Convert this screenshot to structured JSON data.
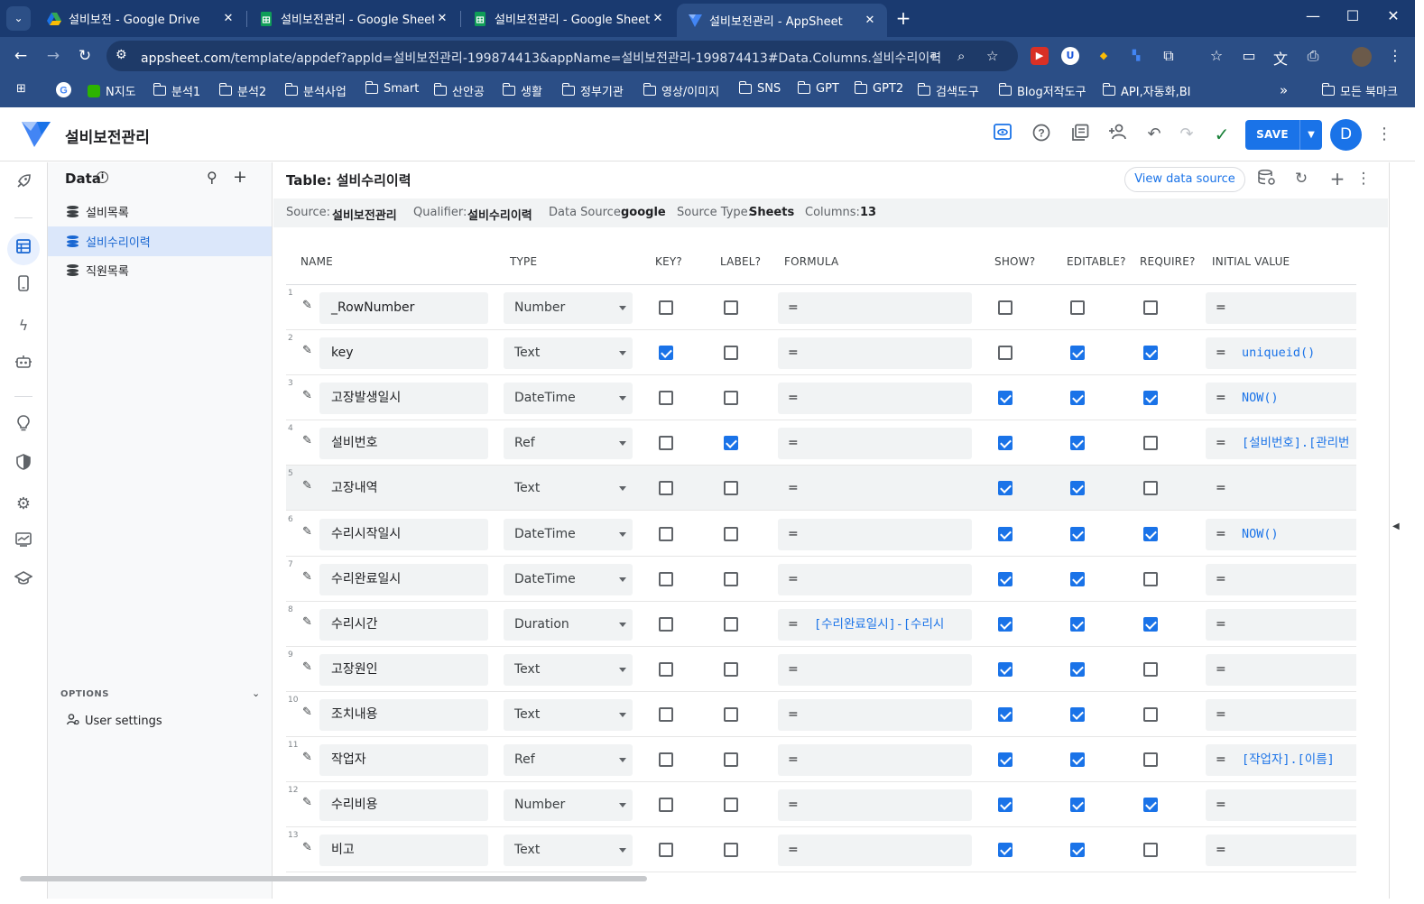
{
  "browser": {
    "tabs": [
      {
        "title": "설비보전 - Google Drive",
        "icon": "google-drive-icon",
        "active": false
      },
      {
        "title": "설비보전관리 - Google Sheets",
        "icon": "google-sheets-icon",
        "active": false
      },
      {
        "title": "설비보전관리 - Google Sheets",
        "icon": "google-sheets-icon",
        "active": false
      },
      {
        "title": "설비보전관리 - AppSheet",
        "icon": "appsheet-icon",
        "active": true
      }
    ],
    "url_domain": "appsheet.com",
    "url_path": "/template/appdef?appId=설비보전관리-199874413&appName=설비보전관리-199874413#Data.Columns.설비수리이력",
    "bookmarks": [
      "N지도",
      "분석1",
      "분석2",
      "분석사업",
      "Smart",
      "산안공",
      "생활",
      "정부기관",
      "영상/이미지",
      "SNS",
      "GPT",
      "GPT2",
      "검색도구",
      "Blog저작도구",
      "API,자동화,BI"
    ],
    "all_bookmarks": "모든 북마크"
  },
  "app": {
    "name": "설비보전관리",
    "save_label": "SAVE",
    "avatar_letter": "D",
    "brand_color": "#1a73e8"
  },
  "sidebar": {
    "title": "Data",
    "tables": [
      {
        "label": "설비목록",
        "selected": false
      },
      {
        "label": "설비수리이력",
        "selected": true
      },
      {
        "label": "직원목록",
        "selected": false
      }
    ],
    "options_label": "OPTIONS",
    "user_settings_label": "User settings"
  },
  "table": {
    "title": "Table: 설비수리이력",
    "view_source_label": "View data source",
    "meta": {
      "source_key": "Source:",
      "source": "설비보전관리",
      "qualifier_key": "Qualifier:",
      "qualifier": "설비수리이력",
      "datasource_key": "Data Source:",
      "datasource": "google",
      "sourcetype_key": "Source Type:",
      "sourcetype": "Sheets",
      "columns_key": "Columns:",
      "columns": "13"
    },
    "headers": {
      "name": "NAME",
      "type": "TYPE",
      "key": "KEY?",
      "label": "LABEL?",
      "formula": "FORMULA",
      "show": "SHOW?",
      "editable": "EDITABLE?",
      "require": "REQUIRE?",
      "initial": "INITIAL VALUE"
    },
    "rows": [
      {
        "num": "1",
        "name": "_RowNumber",
        "type": "Number",
        "key": false,
        "label": false,
        "formula": "",
        "show": false,
        "editable": false,
        "require": false,
        "initial": ""
      },
      {
        "num": "2",
        "name": "key",
        "type": "Text",
        "key": true,
        "label": false,
        "formula": "",
        "show": false,
        "editable": true,
        "require": true,
        "initial": "uniqueid()"
      },
      {
        "num": "3",
        "name": "고장발생일시",
        "type": "DateTime",
        "key": false,
        "label": false,
        "formula": "",
        "show": true,
        "editable": true,
        "require": true,
        "initial": "NOW()"
      },
      {
        "num": "4",
        "name": "설비번호",
        "type": "Ref",
        "key": false,
        "label": true,
        "formula": "",
        "show": true,
        "editable": true,
        "require": false,
        "initial": "[설비번호].[관리번"
      },
      {
        "num": "5",
        "name": "고장내역",
        "type": "Text",
        "key": false,
        "label": false,
        "formula": "",
        "show": true,
        "editable": true,
        "require": false,
        "initial": ""
      },
      {
        "num": "6",
        "name": "수리시작일시",
        "type": "DateTime",
        "key": false,
        "label": false,
        "formula": "",
        "show": true,
        "editable": true,
        "require": true,
        "initial": "NOW()"
      },
      {
        "num": "7",
        "name": "수리완료일시",
        "type": "DateTime",
        "key": false,
        "label": false,
        "formula": "",
        "show": true,
        "editable": true,
        "require": false,
        "initial": ""
      },
      {
        "num": "8",
        "name": "수리시간",
        "type": "Duration",
        "key": false,
        "label": false,
        "formula": "[수리완료일시]-[수리시",
        "show": true,
        "editable": true,
        "require": true,
        "initial": ""
      },
      {
        "num": "9",
        "name": "고장원인",
        "type": "Text",
        "key": false,
        "label": false,
        "formula": "",
        "show": true,
        "editable": true,
        "require": false,
        "initial": ""
      },
      {
        "num": "10",
        "name": "조치내용",
        "type": "Text",
        "key": false,
        "label": false,
        "formula": "",
        "show": true,
        "editable": true,
        "require": false,
        "initial": ""
      },
      {
        "num": "11",
        "name": "작업자",
        "type": "Ref",
        "key": false,
        "label": false,
        "formula": "",
        "show": true,
        "editable": true,
        "require": false,
        "initial": "[작업자].[이름]"
      },
      {
        "num": "12",
        "name": "수리비용",
        "type": "Number",
        "key": false,
        "label": false,
        "formula": "",
        "show": true,
        "editable": true,
        "require": true,
        "initial": ""
      },
      {
        "num": "13",
        "name": "비고",
        "type": "Text",
        "key": false,
        "label": false,
        "formula": "",
        "show": true,
        "editable": true,
        "require": false,
        "initial": ""
      }
    ],
    "eq_sign": "="
  }
}
